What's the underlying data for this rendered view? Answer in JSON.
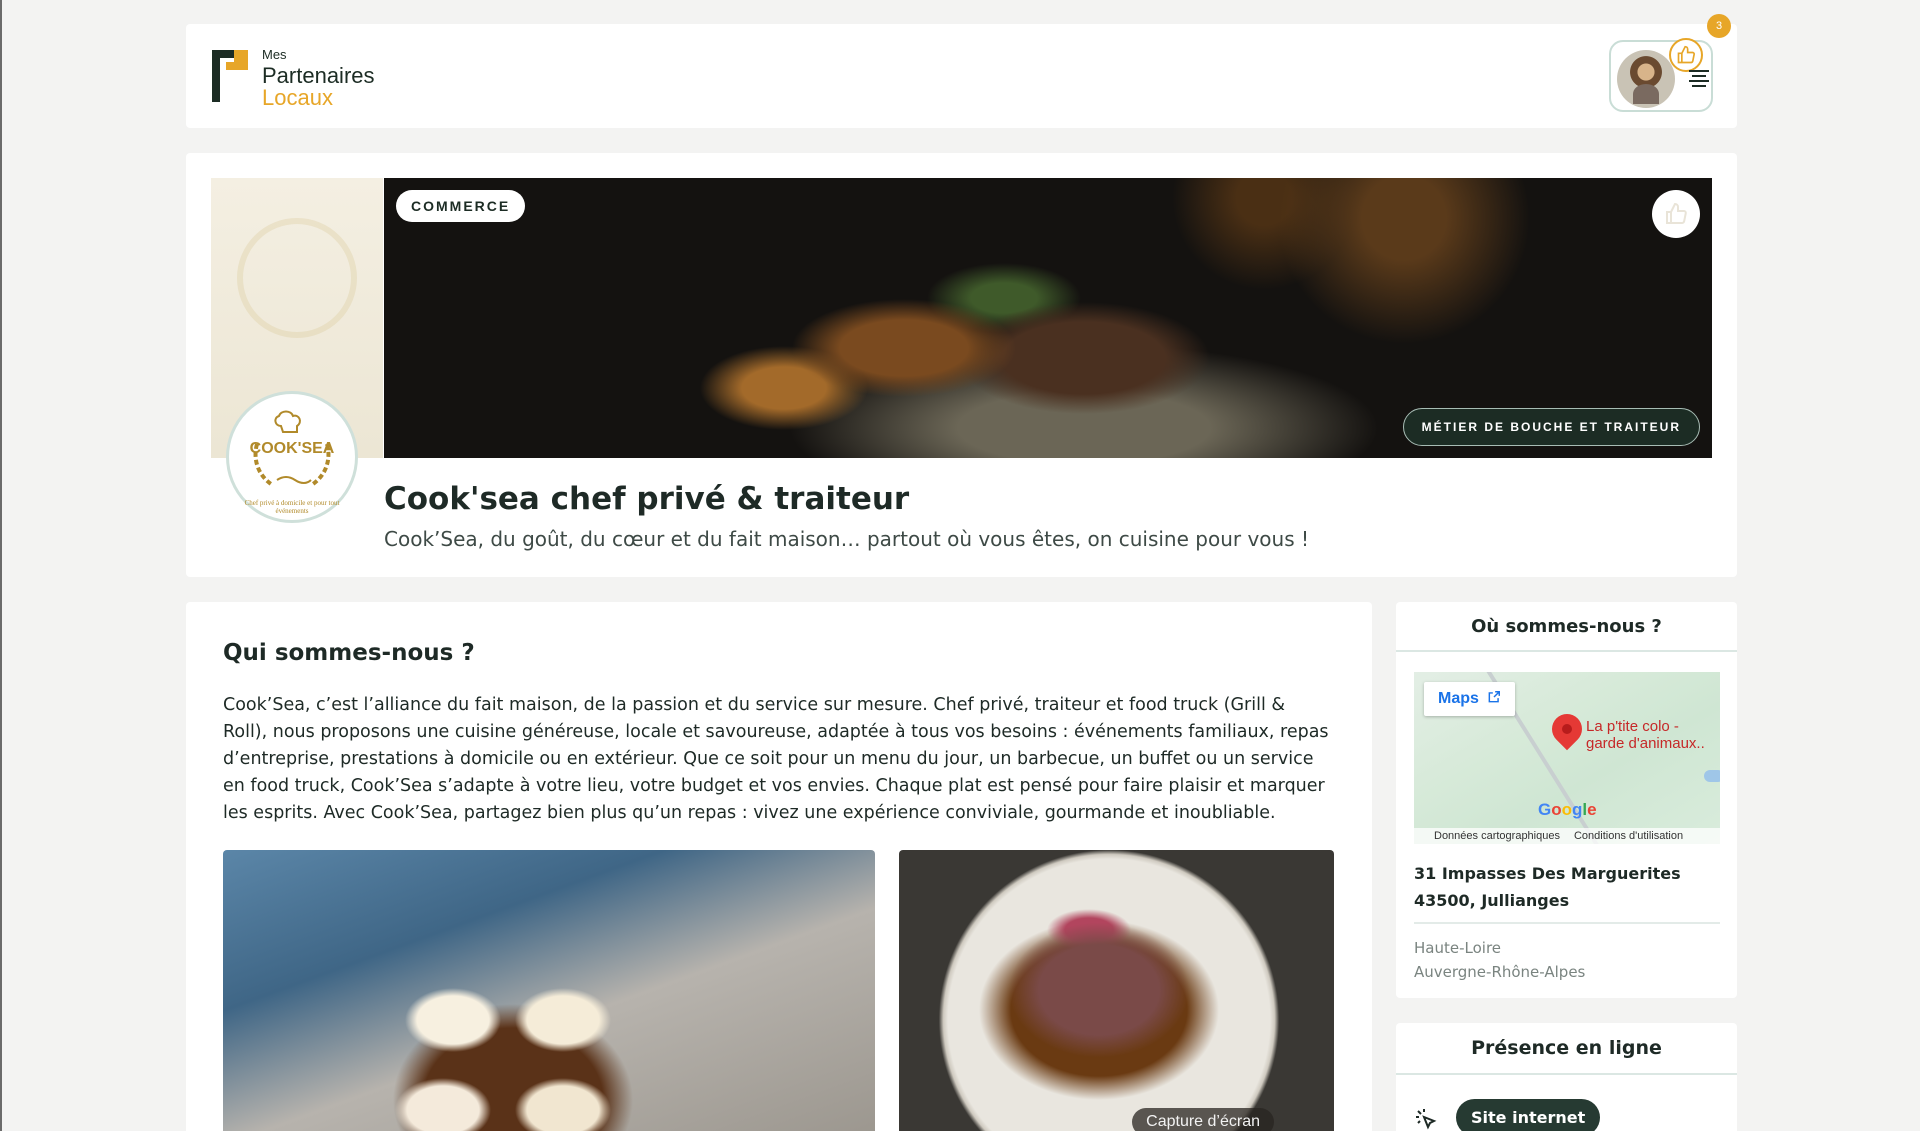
{
  "header": {
    "logo": {
      "line1": "Mes",
      "line2": "Partenaires",
      "line3": "Locaux"
    },
    "notification_count": "3",
    "icons": {
      "like": "thumbs-up-icon",
      "menu": "menu-icon"
    }
  },
  "hero": {
    "category_tag": "COMMERCE",
    "trade_tag": "MÉTIER DE BOUCHE ET TRAITEUR",
    "title": "Cook'sea chef privé & traiteur",
    "subtitle": "Cook’Sea, du goût, du cœur et du fait maison… partout où vous êtes, on cuisine pour vous !",
    "logo_text": "COOK'SEA",
    "logo_sub": "Chef privé à domicile et pour tout événements"
  },
  "about": {
    "heading": "Qui sommes-nous ?",
    "text": "Cook’Sea, c’est l’alliance du fait maison, de la passion et du service sur mesure. Chef privé, traiteur et food truck (Grill & Roll), nous proposons une cuisine généreuse, locale et savoureuse, adaptée à tous vos besoins : événements familiaux, repas d’entreprise, prestations à domicile ou en extérieur. Que ce soit pour un menu du jour, un barbecue, un buffet ou un service en food truck, Cook’Sea s’adapte à votre lieu, votre budget et vos envies. Chaque plat est pensé pour faire plaisir et marquer les esprits. Avec Cook’Sea, partagez bien plus qu’un repas : vivez une expérience conviviale, gourmande et inoubliable.",
    "photo_caption": "Capture d’écran"
  },
  "location": {
    "heading": "Où sommes-nous ?",
    "maps_button": "Maps",
    "pin_label_1": "La p'tite colo -",
    "pin_label_2": "garde d'animaux..",
    "google": "Google",
    "map_data": "Données cartographiques",
    "map_terms": "Conditions d'utilisation",
    "address_line1": "31 Impasses Des Marguerites",
    "address_line2": "43500, Jullianges",
    "department": "Haute-Loire",
    "region": "Auvergne-Rhône-Alpes"
  },
  "online": {
    "heading": "Présence en ligne",
    "site_button": "Site internet"
  }
}
